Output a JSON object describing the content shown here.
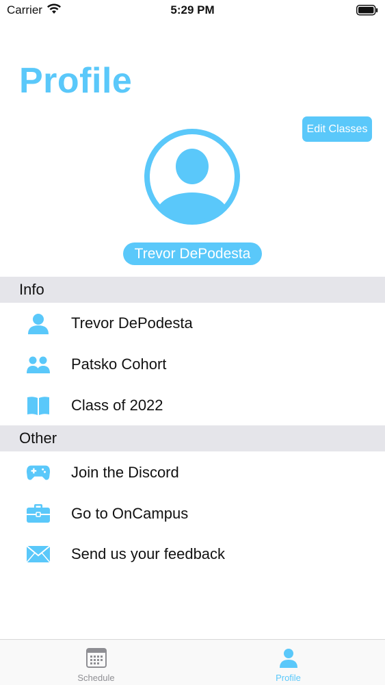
{
  "status_bar": {
    "carrier": "Carrier",
    "time": "5:29 PM"
  },
  "header": {
    "title": "Profile"
  },
  "actions": {
    "edit_classes": "Edit Classes"
  },
  "profile": {
    "name": "Trevor DePodesta"
  },
  "sections": {
    "info": {
      "title": "Info",
      "items": [
        {
          "label": "Trevor DePodesta",
          "icon": "person-icon"
        },
        {
          "label": "Patsko Cohort",
          "icon": "group-icon"
        },
        {
          "label": "Class of 2022",
          "icon": "book-icon"
        }
      ]
    },
    "other": {
      "title": "Other",
      "items": [
        {
          "label": "Join the Discord",
          "icon": "gamepad-icon"
        },
        {
          "label": "Go to OnCampus",
          "icon": "briefcase-icon"
        },
        {
          "label": "Send us your feedback",
          "icon": "envelope-icon"
        }
      ]
    }
  },
  "tabs": [
    {
      "label": "Schedule",
      "icon": "calendar-icon",
      "active": false
    },
    {
      "label": "Profile",
      "icon": "person-icon",
      "active": true
    }
  ],
  "colors": {
    "accent": "#5ac8fa",
    "section_bg": "#e5e5ea",
    "inactive_tab": "#8e8e93"
  }
}
